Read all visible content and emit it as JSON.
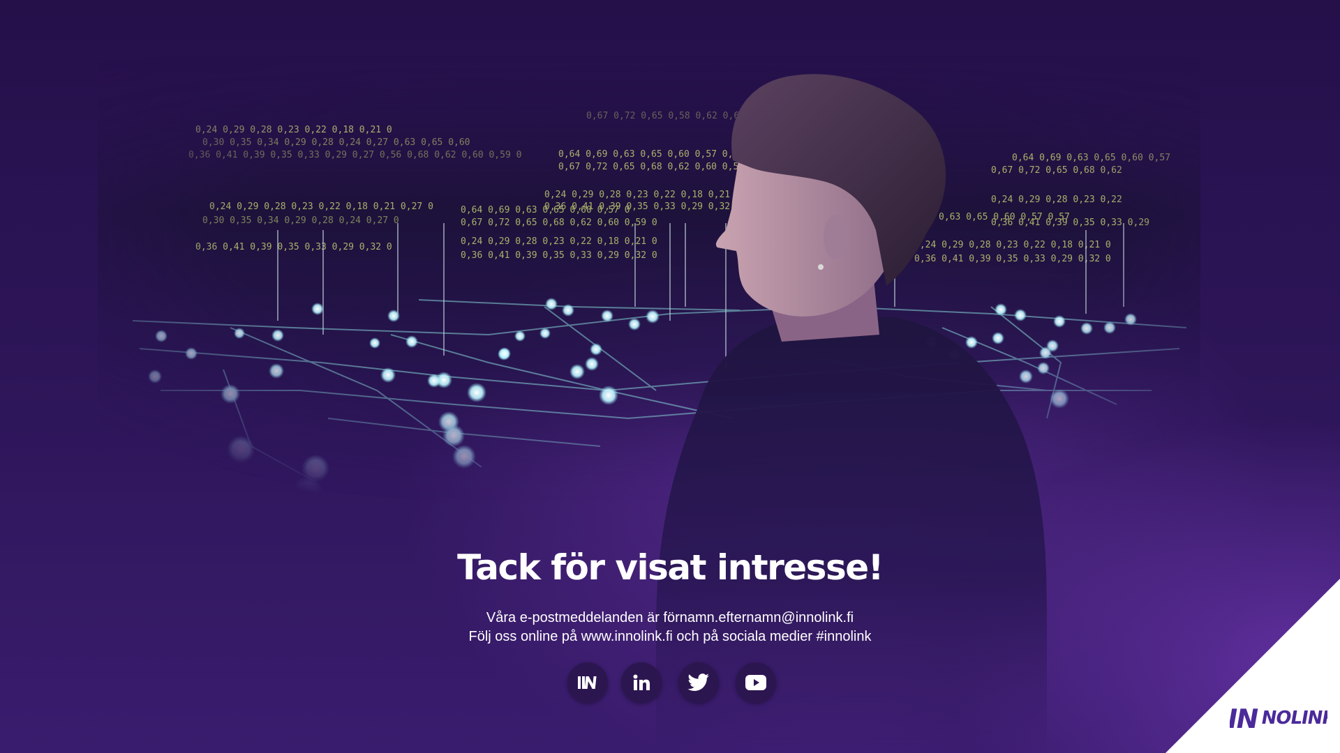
{
  "slide": {
    "heading": "Tack för visat intresse!",
    "email_line": "Våra e-postmeddelanden är förnamn.efternamn@innolink.fi",
    "follow_line": "Följ oss online på www.innolink.fi och på sociala medier #innolink"
  },
  "social_links": [
    {
      "name": "innolink",
      "icon": "innolink-icon",
      "label": "IN"
    },
    {
      "name": "linkedin",
      "icon": "linkedin-icon",
      "label": "in"
    },
    {
      "name": "twitter",
      "icon": "twitter-icon"
    },
    {
      "name": "youtube",
      "icon": "youtube-icon"
    }
  ],
  "brand": {
    "logo_text": "INNOLINK",
    "colors": {
      "background": "#2e165a",
      "accent": "#7a45c8",
      "corner": "#ffffff",
      "logo": "#4b2a9a"
    }
  }
}
